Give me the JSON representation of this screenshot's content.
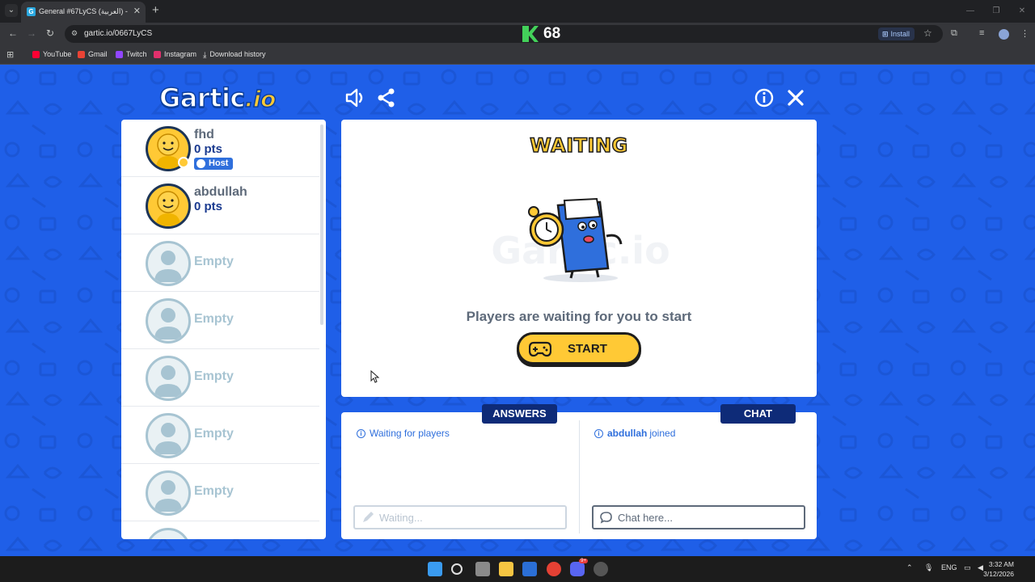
{
  "browser": {
    "tab_title": "General #67LyCS (العربية) - Gar",
    "url": "gartic.io/0667LyCS",
    "install_label": "Install",
    "kick_count": "68",
    "bookmarks": [
      "YouTube",
      "Gmail",
      "Twitch",
      "Instagram",
      "Download history"
    ]
  },
  "game": {
    "logo_text": "Gartic",
    "logo_suffix": ".io",
    "status_title": "WAITING",
    "status_message": "Players are waiting for you to start",
    "start_label": "START",
    "players": [
      {
        "name": "fhd",
        "points": "0 pts",
        "badge": "Host"
      },
      {
        "name": "abdullah",
        "points": "0 pts"
      }
    ],
    "empty_label": "Empty",
    "answers_tab": "ANSWERS",
    "chat_tab": "CHAT",
    "answers_info": "Waiting for players",
    "chat_info_user": "abdullah",
    "chat_info_text": "joined",
    "answers_placeholder": "Waiting...",
    "chat_placeholder": "Chat here..."
  },
  "taskbar": {
    "lang": "ENG",
    "time": "3:32 AM",
    "date": "3/12/2026",
    "badge": "9+"
  },
  "colors": {
    "page_bg": "#1f5fe8",
    "accent_yellow": "#ffc935",
    "navy": "#0e2b78",
    "link_blue": "#2f6fdc"
  }
}
